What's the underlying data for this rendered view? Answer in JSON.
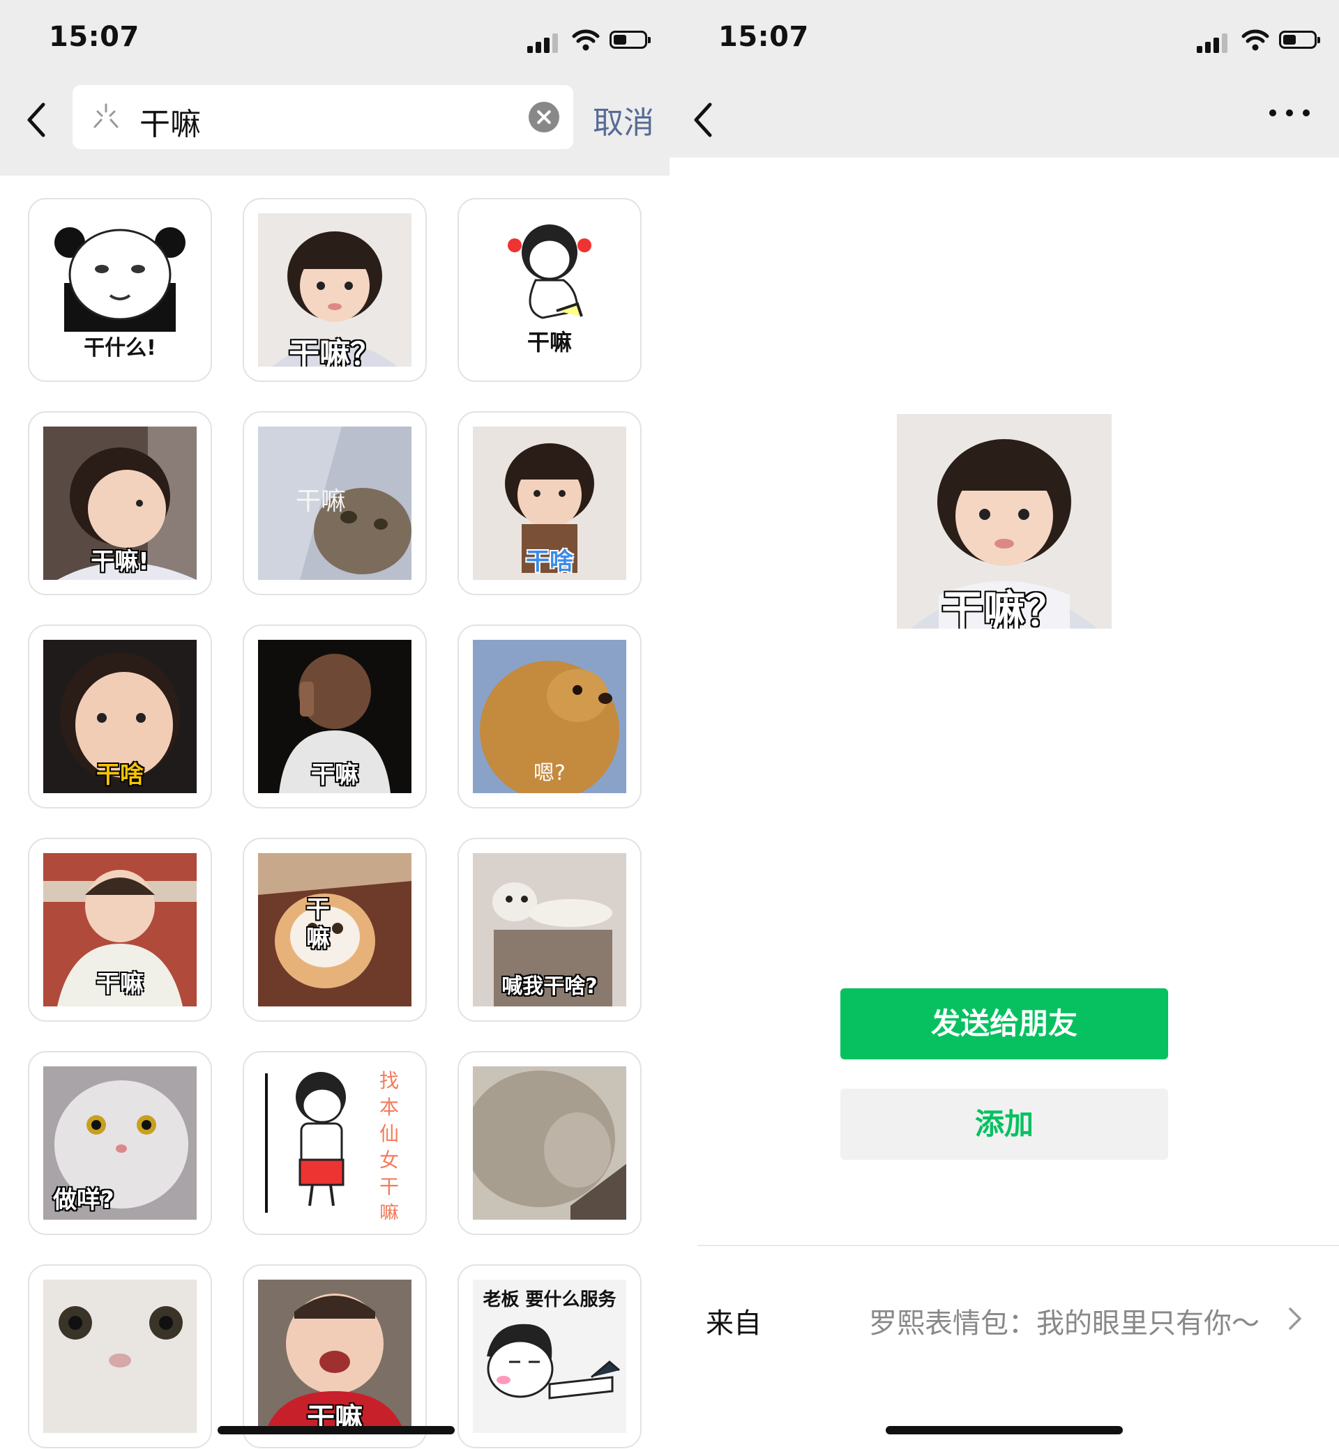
{
  "left": {
    "status": {
      "time": "15:07"
    },
    "search": {
      "query": "干嘛",
      "cancel_label": "取消"
    },
    "stickers": [
      {
        "caption": "干什么!",
        "subject": "panda-meme"
      },
      {
        "caption": "干嘛？",
        "subject": "toddler-girl"
      },
      {
        "caption": "干嘛",
        "subject": "cartoon-girl"
      },
      {
        "caption": "干嘛!",
        "subject": "toddler-girl-sideways"
      },
      {
        "caption": "干嘛",
        "subject": "cat-under-blanket"
      },
      {
        "caption": "干啥",
        "subject": "toddler-girl-drinking"
      },
      {
        "caption": "干啥",
        "subject": "toddler-boy"
      },
      {
        "caption": "干嘛",
        "subject": "baby-on-phone"
      },
      {
        "caption": "嗯?",
        "subject": "golden-dog"
      },
      {
        "caption": "干嘛",
        "subject": "smiling-baby"
      },
      {
        "caption": "干嘛",
        "subject": "orange-cat"
      },
      {
        "caption": "喊我干啥?",
        "subject": "lounging-cat"
      },
      {
        "caption": "做咩?",
        "subject": "grey-cat"
      },
      {
        "caption": "找本仙女干嘛",
        "subject": "cartoon-girl-pole"
      },
      {
        "caption": "",
        "subject": "cat-profile"
      },
      {
        "caption": "",
        "subject": "cat-closeup"
      },
      {
        "caption": "干嘛",
        "subject": "crying-baby"
      },
      {
        "caption": "老板 要什么服务",
        "subject": "cartoon-girl-lying"
      }
    ]
  },
  "right": {
    "status": {
      "time": "15:07"
    },
    "preview_caption": "干嘛？",
    "send_label": "发送给朋友",
    "add_label": "添加",
    "from_label": "来自",
    "from_value": "罗熙表情包：我的眼里只有你～"
  },
  "colors": {
    "accent_green": "#07c160",
    "link_blue": "#576b95",
    "header_bg": "#ededed"
  }
}
